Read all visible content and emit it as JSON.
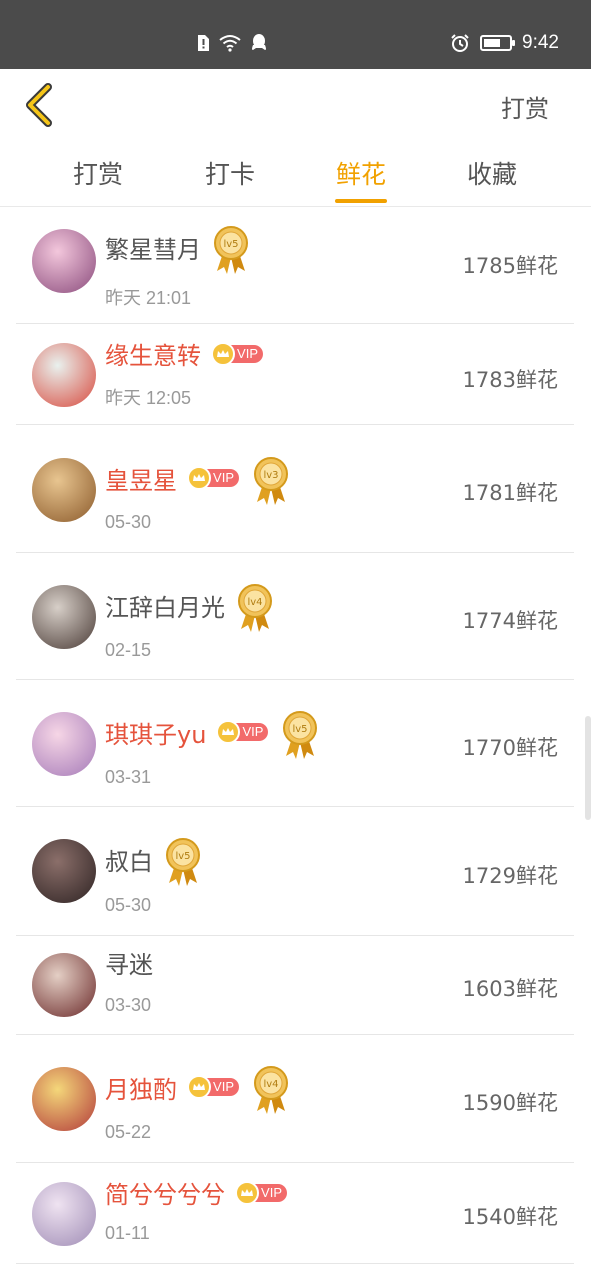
{
  "status_bar": {
    "time": "9:42",
    "icons": [
      "sim-alert-icon",
      "wifi-icon",
      "qq-icon",
      "alarm-icon",
      "battery-icon"
    ],
    "battery_level": 0.65
  },
  "header": {
    "back_icon": "chevron-left-icon",
    "action_label": "打赏"
  },
  "tabs": [
    {
      "label": "打赏",
      "active": false
    },
    {
      "label": "打卡",
      "active": false
    },
    {
      "label": "鲜花",
      "active": true
    },
    {
      "label": "收藏",
      "active": false
    }
  ],
  "colors": {
    "accent": "#f1a100",
    "vip_name": "#e5533c",
    "vip_pill": "#f26a6a",
    "status_bar": "#4b4b4b"
  },
  "rows": [
    {
      "name": "繁星彗月",
      "time": "昨天 21:01",
      "flowers": "1785鲜花",
      "vip": false,
      "medal": "lv5"
    },
    {
      "name": "缘生意转",
      "time": "昨天 12:05",
      "flowers": "1783鲜花",
      "vip": true,
      "vip_label": "VIP",
      "medal": null
    },
    {
      "name": "皇昱星",
      "time": "05-30",
      "flowers": "1781鲜花",
      "vip": true,
      "vip_label": "VIP",
      "medal": "lv3"
    },
    {
      "name": "江辞白月光",
      "time": "02-15",
      "flowers": "1774鲜花",
      "vip": false,
      "medal": "lv4"
    },
    {
      "name": "琪琪子yu",
      "time": "03-31",
      "flowers": "1770鲜花",
      "vip": true,
      "vip_label": "VIP",
      "medal": "lv5"
    },
    {
      "name": "叔白",
      "time": "05-30",
      "flowers": "1729鲜花",
      "vip": false,
      "medal": "lv5"
    },
    {
      "name": "寻迷",
      "time": "03-30",
      "flowers": "1603鲜花",
      "vip": false,
      "medal": null
    },
    {
      "name": "月独酌",
      "time": "05-22",
      "flowers": "1590鲜花",
      "vip": true,
      "vip_label": "VIP",
      "medal": "lv4"
    },
    {
      "name": "简兮兮兮兮",
      "time": "01-11",
      "flowers": "1540鲜花",
      "vip": true,
      "vip_label": "VIP",
      "medal": null
    }
  ]
}
